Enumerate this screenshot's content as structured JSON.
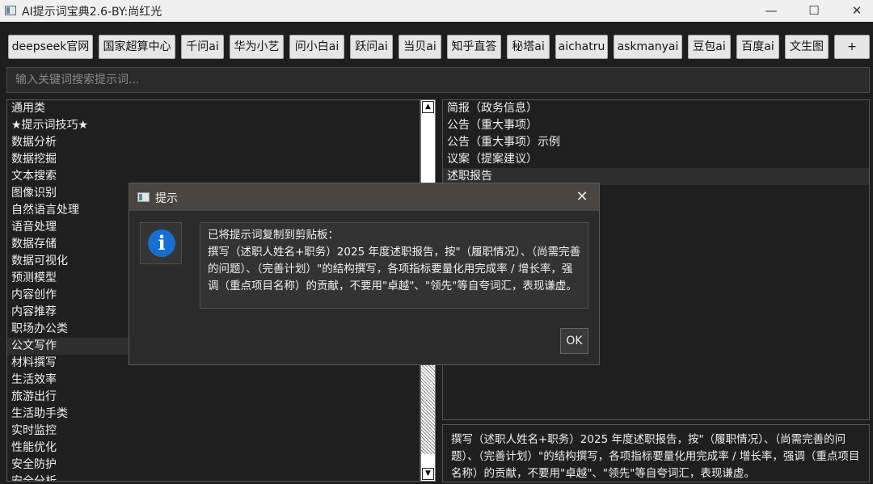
{
  "window": {
    "title": "AI提示词宝典2.6-BY:尚红光",
    "minimize": "—",
    "maximize": "☐",
    "close": "✕"
  },
  "toolbar": {
    "buttons": [
      "deepseek官网",
      "国家超算中心",
      "千问ai",
      "华为小艺",
      "问小白ai",
      "跃问ai",
      "当贝ai",
      "知乎直答",
      "秘塔ai",
      "aichatru",
      "askmanyai",
      "豆包ai",
      "百度ai",
      "文生图",
      "+"
    ]
  },
  "search": {
    "placeholder": "输入关键词搜索提示词..."
  },
  "categories": [
    "通用类",
    "★提示词技巧★",
    "数据分析",
    "数据挖掘",
    "文本搜索",
    "图像识别",
    "自然语言处理",
    "语音处理",
    "数据存储",
    "数据可视化",
    "预测模型",
    "内容创作",
    "内容推荐",
    "职场办公类",
    "公文写作",
    "材料撰写",
    "生活效率",
    "旅游出行",
    "生活助手类",
    "实时监控",
    "性能优化",
    "安全防护",
    "安全分析"
  ],
  "selected_category": "公文写作",
  "prompts": [
    "简报（政务信息）",
    "公告（重大事项）",
    "公告（重大事项）示例",
    "议案（提案建议）",
    "述职报告"
  ],
  "selected_prompt": "述职报告",
  "scrollbar": {
    "up": "▲",
    "down": "▼"
  },
  "preview_text": "撰写（述职人姓名+职务）2025 年度述职报告，按\"（履职情况）、（尚需完善的问题）、（完善计划）\"的结构撰写，各项指标要量化用完成率 / 增长率，强调（重点项目名称）的贡献，不要用\"卓越\"、\"领先\"等自夸词汇，表现谦虚。",
  "dialog": {
    "title": "提示",
    "close": "✕",
    "icon": "i",
    "message_heading": "已将提示词复制到剪贴板：",
    "message_body": "撰写（述职人姓名+职务）2025 年度述职报告，按\"（履职情况）、（尚需完善的问题）、（完善计划）\"的结构撰写，各项指标要量化用完成率 / 增长率，强调（重点项目名称）的贡献，不要用\"卓越\"、\"领先\"等自夸词汇，表现谦虚。",
    "ok_label": "OK"
  }
}
